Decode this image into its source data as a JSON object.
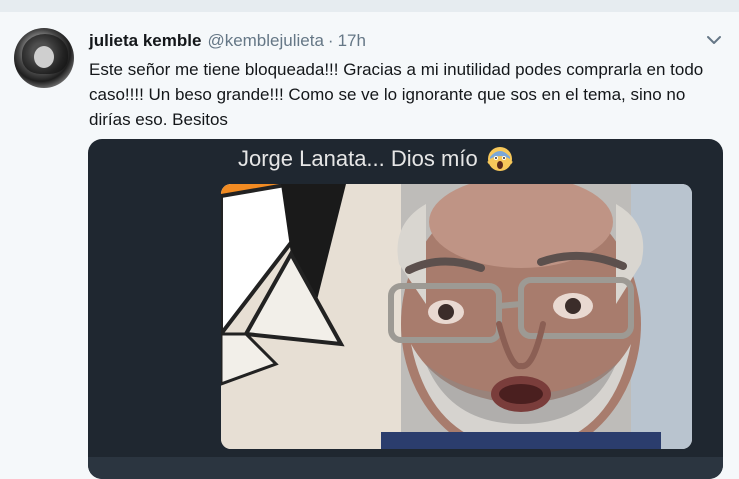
{
  "tweet": {
    "display_name": "julieta kemble",
    "handle": "@kemblejulieta",
    "separator": "·",
    "time": "17h",
    "text": "Este señor me tiene bloqueada!!! Gracias a mi inutilidad podes comprarla en todo caso!!!! Un beso grande!!! Como se ve lo ignorante que sos en el tema, sino no dirías eso. Besitos"
  },
  "media": {
    "caption": "Jorge Lanata... Dios mío",
    "emoji_icon": "screaming-face-icon"
  },
  "icons": {
    "menu": "chevron-down-icon",
    "avatar": "avatar"
  },
  "colors": {
    "background": "#f5f8fa",
    "name": "#14171a",
    "secondary": "#657786",
    "media_bg": "#1f2730"
  }
}
